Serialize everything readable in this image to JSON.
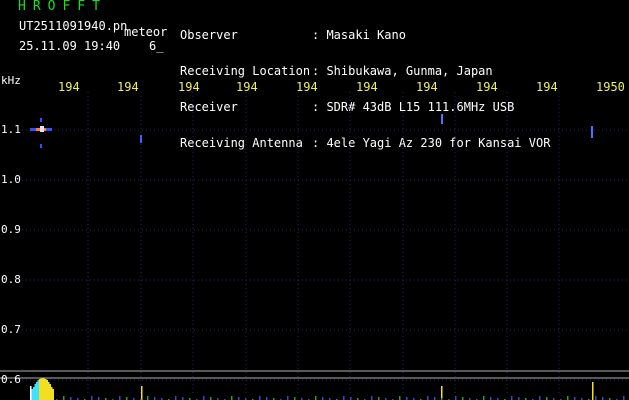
{
  "header": {
    "title": "HROFFT",
    "filename": "UT2511091940.pn",
    "mode": "meteor",
    "datetime": "25.11.09 19:40    6_",
    "info": [
      {
        "key": "Observer",
        "value": ": Masaki Kano"
      },
      {
        "key": "Receiving Location",
        "value": ": Shibukawa, Gunma, Japan"
      },
      {
        "key": "Receiver",
        "value": ": SDR# 43dB L15 111.6MHz USB"
      },
      {
        "key": "Receiving Antenna",
        "value": ": 4ele Yagi Az 230 for Kansai VOR"
      }
    ]
  },
  "axes": {
    "y_unit": "kHz",
    "y_ticks": [
      "1.1",
      "1.0",
      "0.9",
      "0.8",
      "0.7",
      "0.6"
    ],
    "x_ticks": [
      "194",
      "194",
      "194",
      "194",
      "194",
      "194",
      "194",
      "194",
      "194",
      "1950"
    ]
  },
  "colors": {
    "background": "#000000",
    "grid": "#1c2a6a",
    "title": "#18e018",
    "tick_label": "#f0f060",
    "text": "#ffffff"
  }
}
